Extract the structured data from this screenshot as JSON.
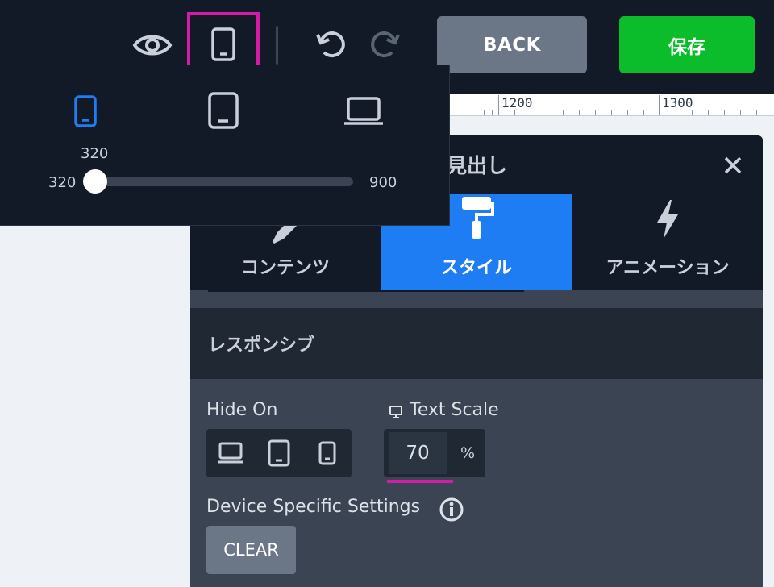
{
  "toolbar": {
    "back_label": "BACK",
    "save_label": "保存",
    "icons": [
      "eye-icon",
      "tablet-icon",
      "undo-icon",
      "redo-icon"
    ]
  },
  "ruler": {
    "labels": [
      "1200",
      "1300"
    ]
  },
  "device_popover": {
    "devices": [
      "mobile-icon",
      "tablet-icon",
      "laptop-icon"
    ],
    "selected_device": "mobile",
    "current_value": "320",
    "min_label": "320",
    "max_label": "900",
    "slider_fraction": 0
  },
  "panel": {
    "title": "見出し",
    "tabs": [
      {
        "label": "コンテンツ",
        "icon": "pencil-icon"
      },
      {
        "label": "スタイル",
        "icon": "paint-roller-icon",
        "active": true
      },
      {
        "label": "アニメーション",
        "icon": "bolt-icon"
      }
    ],
    "section_title": "レスポンシブ",
    "hide_on_label": "Hide On",
    "hide_on_options": [
      "laptop-icon",
      "tablet-icon",
      "mobile-icon"
    ],
    "text_scale_label": "Text Scale",
    "text_scale_value": "70",
    "text_scale_unit": "%",
    "device_specific_label": "Device Specific Settings",
    "clear_label": "CLEAR"
  },
  "colors": {
    "dark_bg": "#111a26",
    "accent_blue": "#1e7df2",
    "save_green": "#0bbd2a",
    "highlight_magenta": "#d41aa8",
    "button_gray": "#6b7686"
  }
}
